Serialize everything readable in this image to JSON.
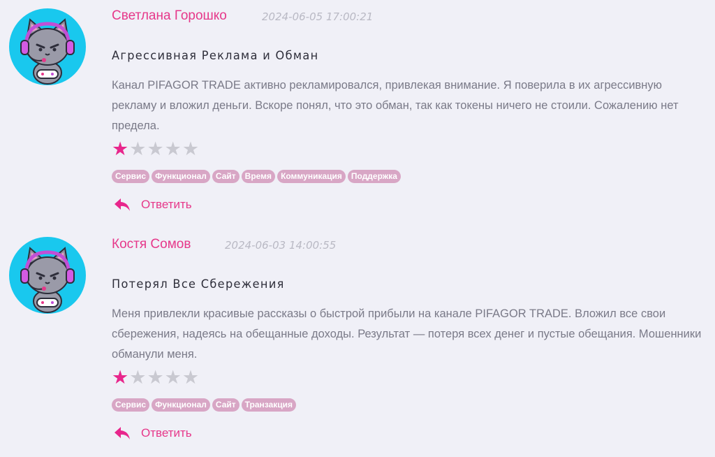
{
  "reviews": [
    {
      "author": "Светлана Горошко",
      "date": "2024-06-05 17:00:21",
      "title": "Агрессивная Реклама и Обман",
      "body": "Канал PIFAGOR TRADE активно рекламировался, привлекая внимание. Я поверила в их агрессивную рекламу и вложил деньги. Вскоре понял, что это обман, так как токены ничего не стоили. Сожалению нет предела.",
      "rating": 1,
      "max_rating": 5,
      "tags": [
        "Сервис",
        "Функционал",
        "Сайт",
        "Время",
        "Коммуникация",
        "Поддержка"
      ],
      "reply_label": "Ответить",
      "avatar_icon": "gamer-cat-avatar-icon"
    },
    {
      "author": "Костя Сомов",
      "date": "2024-06-03 14:00:55",
      "title": "Потерял Все Сбережения",
      "body": "Меня привлекли красивые рассказы о быстрой прибыли на канале PIFAGOR TRADE. Вложил все свои сбережения, надеясь на обещанные доходы. Результат — потеря всех денег и пустые обещания. Мошенники обманули меня.",
      "rating": 1,
      "max_rating": 5,
      "tags": [
        "Сервис",
        "Функционал",
        "Сайт",
        "Транзакция"
      ],
      "reply_label": "Ответить",
      "avatar_icon": "gamer-cat-avatar-icon"
    }
  ],
  "colors": {
    "accent": "#e6388a",
    "star_active": "#e8268c",
    "star_inactive": "#c9c9d1",
    "tag_bg": "#d8a6c5",
    "avatar_bg": "#19c8ee",
    "page_bg": "#f0f0f7"
  }
}
